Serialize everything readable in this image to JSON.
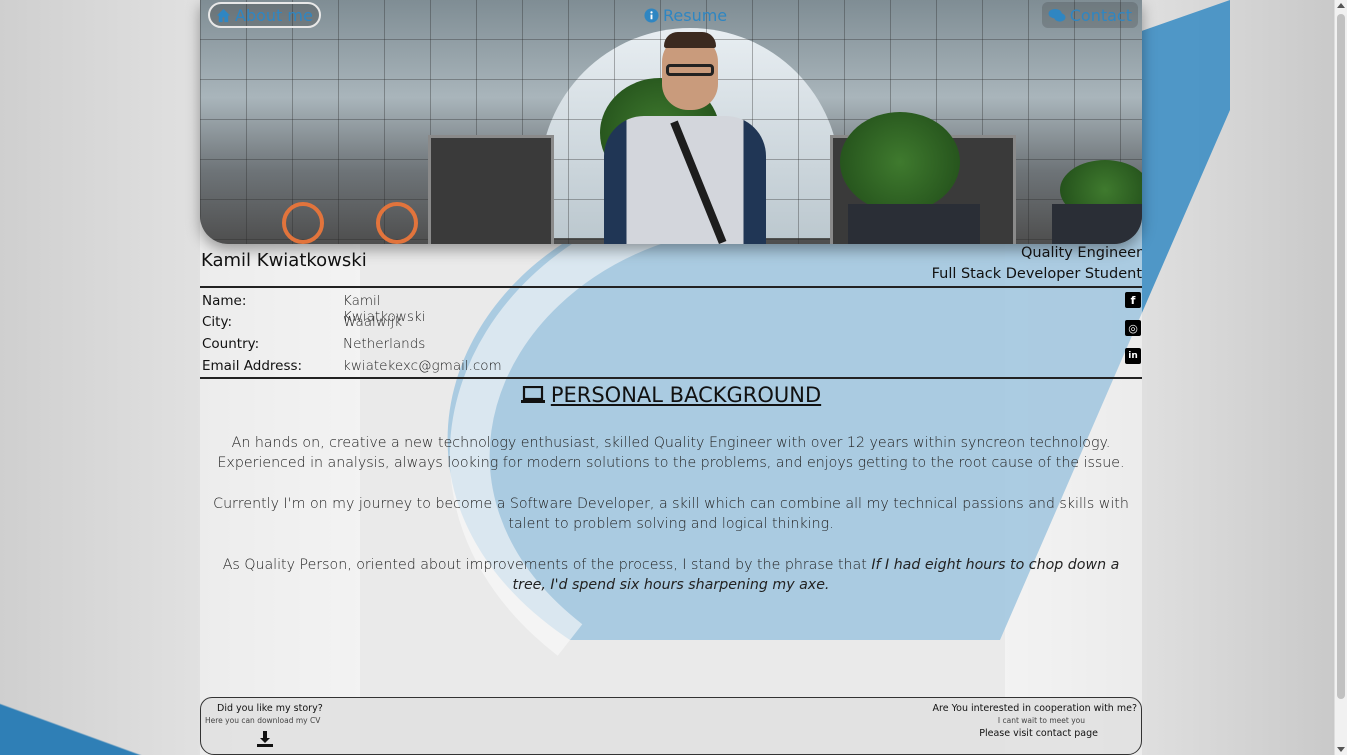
{
  "nav": {
    "about": "About me",
    "resume": "Resume",
    "contact": "Contact"
  },
  "profile": {
    "name": "Kamil Kwiatkowski",
    "role1": "Quality Engineer",
    "role2": "Full Stack Developer Student"
  },
  "info": [
    {
      "label": "Name:",
      "value": "Kamil Kwiatkowski"
    },
    {
      "label": "City:",
      "value": "Waalwijk"
    },
    {
      "label": "Country:",
      "value": "Netherlands"
    },
    {
      "label": "Email Address:",
      "value": "kwiatekexc@gmail.com"
    }
  ],
  "social": {
    "facebook": "f",
    "instagram": "◎",
    "linkedin": "in"
  },
  "background": {
    "title": "PERSONAL BACKGROUND",
    "p1": "An hands on, creative a new technology enthusiast, skilled Quality Engineer with over 12 years within syncreon technology. Experienced in analysis, always looking for modern solutions to the problems, and enjoys getting to the root cause of the issue.",
    "p2": "Currently I'm on my journey to become a Software Developer, a skill which can combine all my technical passions and skills with talent to problem solving and logical thinking.",
    "p3_plain": "As Quality Person, oriented about improvements of the process, I stand by the phrase that ",
    "p3_quote": "If I had eight hours to chop down a tree, I'd spend six hours sharpening my axe."
  },
  "footer": {
    "left_title": "Did you like my story?",
    "left_sub": "Here you can download my CV",
    "right_title": "Are You interested in cooperation with me?",
    "right_sub": "I cant wait to meet you",
    "right_link": "Please visit contact page"
  },
  "colors": {
    "accent": "#2f86c2",
    "blue_shape": "#2f7fb6"
  }
}
